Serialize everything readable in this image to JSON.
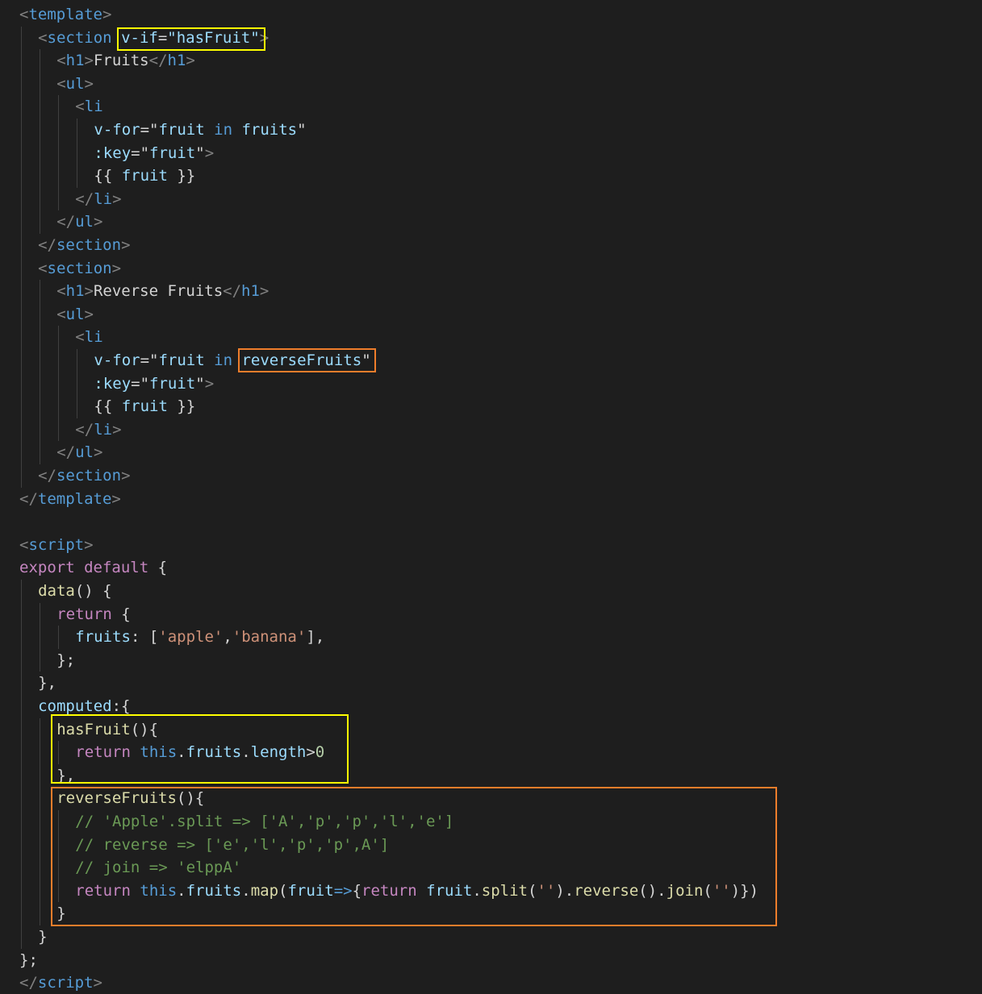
{
  "editor": {
    "language": "vue",
    "theme_colors": {
      "background": "#1e1e1e",
      "highlight_yellow": "#ffff00",
      "highlight_orange": "#ee7d2b"
    },
    "highlights": [
      {
        "color": "yellow",
        "target": "v-if=\"hasFruit\""
      },
      {
        "color": "orange",
        "target": "reverseFruits\""
      },
      {
        "color": "yellow",
        "target": "hasFruit computed"
      },
      {
        "color": "orange",
        "target": "reverseFruits computed"
      }
    ],
    "lines": [
      [
        [
          "p",
          "<"
        ],
        [
          "tg",
          "template"
        ],
        [
          "p",
          ">"
        ]
      ],
      [
        [
          "p",
          "<"
        ],
        [
          "tg",
          "section"
        ],
        [
          "tx",
          " "
        ],
        [
          "at",
          "v-if"
        ],
        [
          "tx",
          "="
        ],
        [
          "at",
          "\"hasFruit\""
        ],
        [
          "p",
          ">"
        ]
      ],
      [
        [
          "p",
          "<"
        ],
        [
          "tg",
          "h1"
        ],
        [
          "p",
          ">"
        ],
        [
          "tx",
          "Fruits"
        ],
        [
          "p",
          "</"
        ],
        [
          "tg",
          "h1"
        ],
        [
          "p",
          ">"
        ]
      ],
      [
        [
          "p",
          "<"
        ],
        [
          "tg",
          "ul"
        ],
        [
          "p",
          ">"
        ]
      ],
      [
        [
          "p",
          "<"
        ],
        [
          "tg",
          "li"
        ]
      ],
      [
        [
          "at",
          "v-for"
        ],
        [
          "tx",
          "=\""
        ],
        [
          "at",
          "fruit"
        ],
        [
          "tx",
          " "
        ],
        [
          "bl",
          "in"
        ],
        [
          "tx",
          " "
        ],
        [
          "at",
          "fruits"
        ],
        [
          "tx",
          "\""
        ]
      ],
      [
        [
          "at",
          ":key"
        ],
        [
          "tx",
          "=\""
        ],
        [
          "at",
          "fruit"
        ],
        [
          "tx",
          "\""
        ],
        [
          "p",
          ">"
        ]
      ],
      [
        [
          "tx",
          "{{ "
        ],
        [
          "at",
          "fruit"
        ],
        [
          "tx",
          " }}"
        ]
      ],
      [
        [
          "p",
          "</"
        ],
        [
          "tg",
          "li"
        ],
        [
          "p",
          ">"
        ]
      ],
      [
        [
          "p",
          "</"
        ],
        [
          "tg",
          "ul"
        ],
        [
          "p",
          ">"
        ]
      ],
      [
        [
          "p",
          "</"
        ],
        [
          "tg",
          "section"
        ],
        [
          "p",
          ">"
        ]
      ],
      [
        [
          "p",
          "<"
        ],
        [
          "tg",
          "section"
        ],
        [
          "p",
          ">"
        ]
      ],
      [
        [
          "p",
          "<"
        ],
        [
          "tg",
          "h1"
        ],
        [
          "p",
          ">"
        ],
        [
          "tx",
          "Reverse Fruits"
        ],
        [
          "p",
          "</"
        ],
        [
          "tg",
          "h1"
        ],
        [
          "p",
          ">"
        ]
      ],
      [
        [
          "p",
          "<"
        ],
        [
          "tg",
          "ul"
        ],
        [
          "p",
          ">"
        ]
      ],
      [
        [
          "p",
          "<"
        ],
        [
          "tg",
          "li"
        ]
      ],
      [
        [
          "at",
          "v-for"
        ],
        [
          "tx",
          "=\""
        ],
        [
          "at",
          "fruit"
        ],
        [
          "tx",
          " "
        ],
        [
          "bl",
          "in"
        ],
        [
          "tx",
          " "
        ],
        [
          "at",
          "reverseFruits"
        ],
        [
          "tx",
          "\""
        ]
      ],
      [
        [
          "at",
          ":key"
        ],
        [
          "tx",
          "=\""
        ],
        [
          "at",
          "fruit"
        ],
        [
          "tx",
          "\""
        ],
        [
          "p",
          ">"
        ]
      ],
      [
        [
          "tx",
          "{{ "
        ],
        [
          "at",
          "fruit"
        ],
        [
          "tx",
          " }}"
        ]
      ],
      [
        [
          "p",
          "</"
        ],
        [
          "tg",
          "li"
        ],
        [
          "p",
          ">"
        ]
      ],
      [
        [
          "p",
          "</"
        ],
        [
          "tg",
          "ul"
        ],
        [
          "p",
          ">"
        ]
      ],
      [
        [
          "p",
          "</"
        ],
        [
          "tg",
          "section"
        ],
        [
          "p",
          ">"
        ]
      ],
      [
        [
          "p",
          "</"
        ],
        [
          "tg",
          "template"
        ],
        [
          "p",
          ">"
        ]
      ],
      [],
      [
        [
          "p",
          "<"
        ],
        [
          "tg",
          "script"
        ],
        [
          "p",
          ">"
        ]
      ],
      [
        [
          "kw",
          "export"
        ],
        [
          "tx",
          " "
        ],
        [
          "kw",
          "default"
        ],
        [
          "tx",
          " {"
        ]
      ],
      [
        [
          "fn",
          "data"
        ],
        [
          "tx",
          "() {"
        ]
      ],
      [
        [
          "kw",
          "return"
        ],
        [
          "tx",
          " {"
        ]
      ],
      [
        [
          "at",
          "fruits"
        ],
        [
          "tx",
          ": ["
        ],
        [
          "st",
          "'apple'"
        ],
        [
          "tx",
          ","
        ],
        [
          "st",
          "'banana'"
        ],
        [
          "tx",
          "],"
        ]
      ],
      [
        [
          "tx",
          "};"
        ]
      ],
      [
        [
          "tx",
          "},"
        ]
      ],
      [
        [
          "at",
          "computed"
        ],
        [
          "tx",
          ":{"
        ]
      ],
      [
        [
          "fn",
          "hasFruit"
        ],
        [
          "tx",
          "(){"
        ]
      ],
      [
        [
          "kw",
          "return"
        ],
        [
          "tx",
          " "
        ],
        [
          "bl",
          "this"
        ],
        [
          "tx",
          "."
        ],
        [
          "at",
          "fruits"
        ],
        [
          "tx",
          "."
        ],
        [
          "at",
          "length"
        ],
        [
          "tx",
          ">"
        ],
        [
          "nm",
          "0"
        ]
      ],
      [
        [
          "tx",
          "},"
        ]
      ],
      [
        [
          "fn",
          "reverseFruits"
        ],
        [
          "tx",
          "(){"
        ]
      ],
      [
        [
          "cm",
          "// 'Apple'.split => ['A','p','p','l','e']"
        ]
      ],
      [
        [
          "cm",
          "// reverse => ['e','l','p','p',A']"
        ]
      ],
      [
        [
          "cm",
          "// join => 'elppA'"
        ]
      ],
      [
        [
          "kw",
          "return"
        ],
        [
          "tx",
          " "
        ],
        [
          "bl",
          "this"
        ],
        [
          "tx",
          "."
        ],
        [
          "at",
          "fruits"
        ],
        [
          "tx",
          "."
        ],
        [
          "fn",
          "map"
        ],
        [
          "tx",
          "("
        ],
        [
          "at",
          "fruit"
        ],
        [
          "bl",
          "=>"
        ],
        [
          "tx",
          "{"
        ],
        [
          "kw",
          "return"
        ],
        [
          "tx",
          " "
        ],
        [
          "at",
          "fruit"
        ],
        [
          "tx",
          "."
        ],
        [
          "fn",
          "split"
        ],
        [
          "tx",
          "("
        ],
        [
          "st",
          "''"
        ],
        [
          "tx",
          ")."
        ],
        [
          "fn",
          "reverse"
        ],
        [
          "tx",
          "()."
        ],
        [
          "fn",
          "join"
        ],
        [
          "tx",
          "("
        ],
        [
          "st",
          "''"
        ],
        [
          "tx",
          ")})"
        ]
      ],
      [
        [
          "tx",
          "}"
        ]
      ],
      [
        [
          "tx",
          "}"
        ]
      ],
      [
        [
          "tx",
          "};"
        ]
      ],
      [
        [
          "p",
          "</"
        ],
        [
          "tg",
          "script"
        ],
        [
          "p",
          ">"
        ]
      ]
    ]
  }
}
